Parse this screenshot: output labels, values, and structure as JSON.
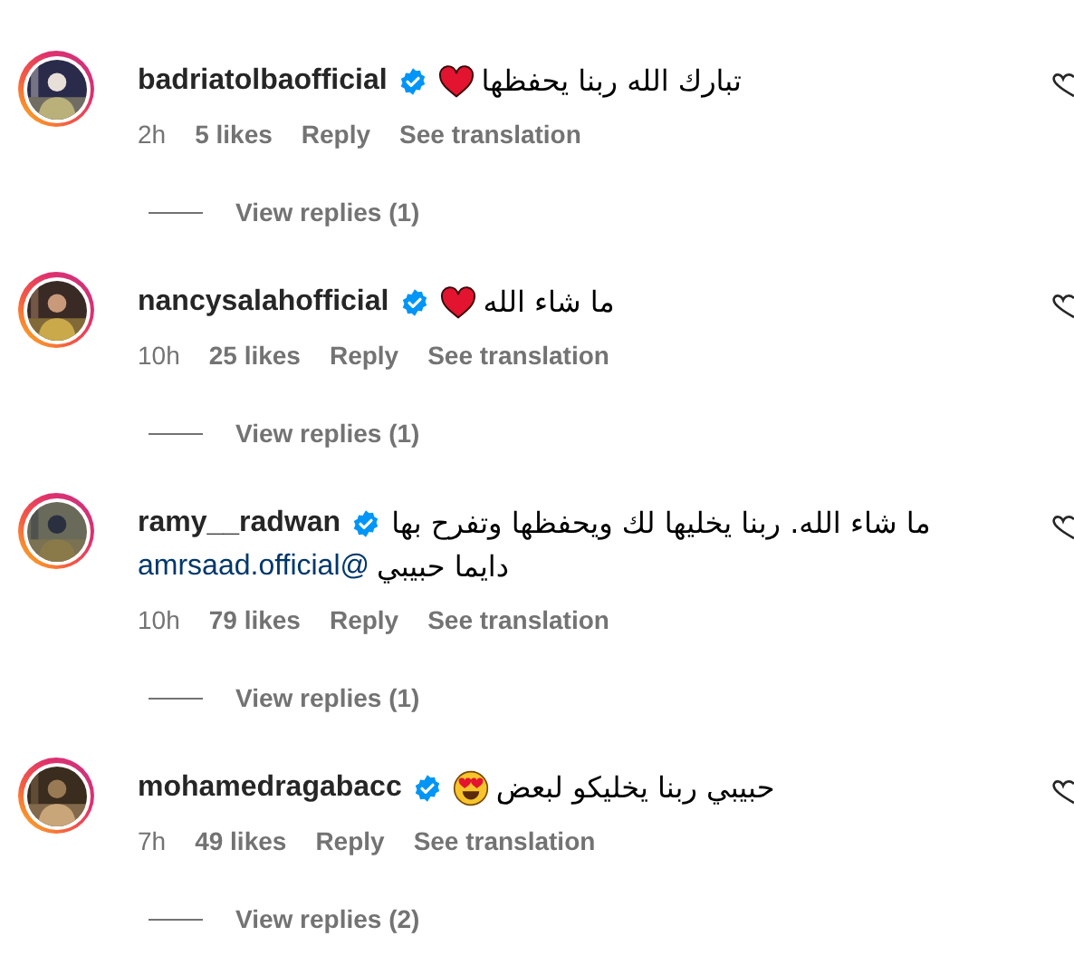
{
  "comments": [
    {
      "username": "badriatolbaofficial",
      "verified": true,
      "lines": [
        [
          {
            "kind": "heart"
          },
          {
            "kind": "text",
            "text": "تبارك الله ربنا يحفظها"
          }
        ]
      ],
      "time": "2h",
      "likes": "5 likes",
      "reply": "Reply",
      "translate": "See translation",
      "view_replies": "View replies (1)"
    },
    {
      "username": "nancysalahofficial",
      "verified": true,
      "lines": [
        [
          {
            "kind": "heart"
          },
          {
            "kind": "text",
            "text": " ما شاء الله"
          }
        ]
      ],
      "time": "10h",
      "likes": "25 likes",
      "reply": "Reply",
      "translate": "See translation",
      "view_replies": "View replies (1)"
    },
    {
      "username": "ramy__radwan",
      "verified": true,
      "lines": [
        [
          {
            "kind": "text",
            "text": "ما شاء الله. ربنا يخليها لك ويحفظها وتفرح بها"
          }
        ],
        [
          {
            "kind": "mention",
            "text": "@amrsaad.official"
          },
          {
            "kind": "text",
            "text": " دايما حبيبي"
          }
        ]
      ],
      "time": "10h",
      "likes": "79 likes",
      "reply": "Reply",
      "translate": "See translation",
      "view_replies": "View replies (1)"
    },
    {
      "username": "mohamedragabacc",
      "verified": true,
      "lines": [
        [
          {
            "kind": "heart_eyes"
          },
          {
            "kind": "text",
            "text": " حبيبي ربنا يخليكو لبعض"
          }
        ]
      ],
      "time": "7h",
      "likes": "49 likes",
      "reply": "Reply",
      "translate": "See translation",
      "view_replies": "View replies (2)"
    }
  ]
}
